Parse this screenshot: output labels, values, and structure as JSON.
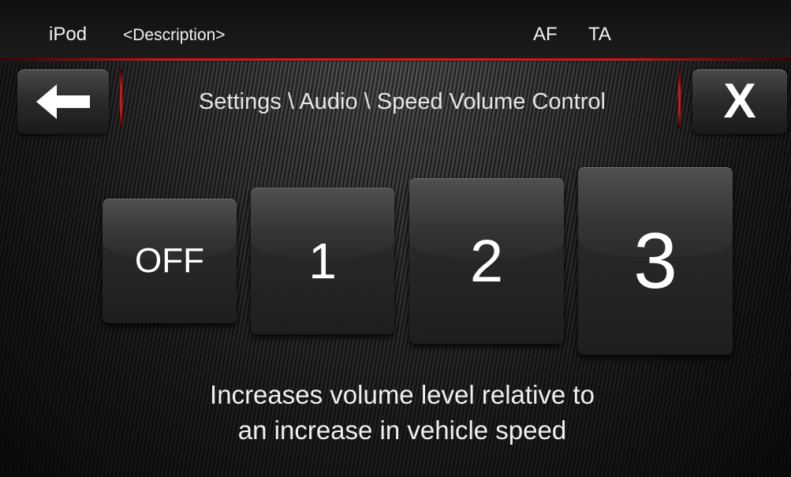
{
  "status_bar": {
    "source": "iPod",
    "description": "<Description>",
    "indicators": [
      "AF",
      "TA"
    ]
  },
  "header": {
    "back_icon": "arrow-left-icon",
    "breadcrumb": "Settings \\ Audio \\ Speed Volume Control",
    "close_label": "X",
    "accent_color": "#d21414"
  },
  "levels": {
    "options": [
      "OFF",
      "1",
      "2",
      "3"
    ]
  },
  "description": {
    "line1": "Increases volume level relative to",
    "line2": "an increase in vehicle speed"
  }
}
